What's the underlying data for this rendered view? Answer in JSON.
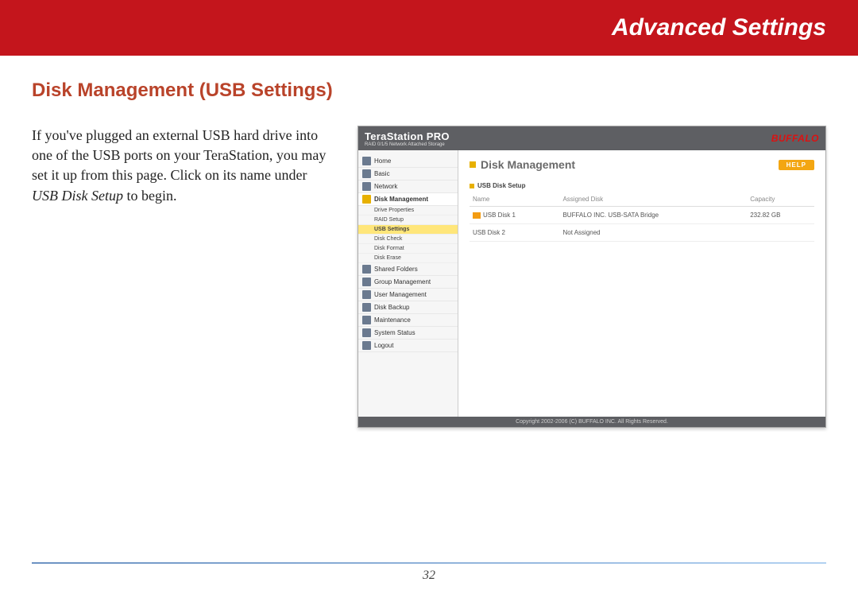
{
  "header": {
    "title": "Advanced Settings"
  },
  "section": {
    "title": "Disk Management (USB Settings)"
  },
  "blurb": {
    "pre": "If you've plugged an external USB hard drive into one of the USB ports on your TeraStation, you may set it up from this page.  Click on its name under ",
    "em": "USB Disk Setup",
    "post": " to begin."
  },
  "screenshot": {
    "product": "TeraStation PRO",
    "tagline": "RAID 0/1/5 Network Attached Storage",
    "brand": "BUFFALO",
    "nav": {
      "items": [
        {
          "label": "Home",
          "type": "top"
        },
        {
          "label": "Basic",
          "type": "top"
        },
        {
          "label": "Network",
          "type": "top"
        },
        {
          "label": "Disk Management",
          "type": "top",
          "selected": true
        },
        {
          "label": "Drive Properties",
          "type": "sub"
        },
        {
          "label": "RAID Setup",
          "type": "sub"
        },
        {
          "label": "USB Settings",
          "type": "sub",
          "highlight": true
        },
        {
          "label": "Disk Check",
          "type": "sub"
        },
        {
          "label": "Disk Format",
          "type": "sub"
        },
        {
          "label": "Disk Erase",
          "type": "sub"
        },
        {
          "label": "Shared Folders",
          "type": "top"
        },
        {
          "label": "Group Management",
          "type": "top"
        },
        {
          "label": "User Management",
          "type": "top"
        },
        {
          "label": "Disk Backup",
          "type": "top"
        },
        {
          "label": "Maintenance",
          "type": "top"
        },
        {
          "label": "System Status",
          "type": "top"
        },
        {
          "label": "Logout",
          "type": "top"
        }
      ]
    },
    "main": {
      "title": "Disk Management",
      "help": "HELP",
      "subsection": "USB Disk Setup",
      "columns": {
        "name": "Name",
        "assigned": "Assigned Disk",
        "capacity": "Capacity"
      },
      "rows": [
        {
          "name": "USB Disk 1",
          "assigned": "BUFFALO INC. USB-SATA Bridge",
          "capacity": "232.82 GB",
          "icon": true
        },
        {
          "name": "USB Disk 2",
          "assigned": "Not Assigned",
          "capacity": "",
          "icon": false
        }
      ]
    },
    "footer": "Copyright 2002-2006 (C) BUFFALO INC. All Rights Reserved."
  },
  "page_number": "32"
}
